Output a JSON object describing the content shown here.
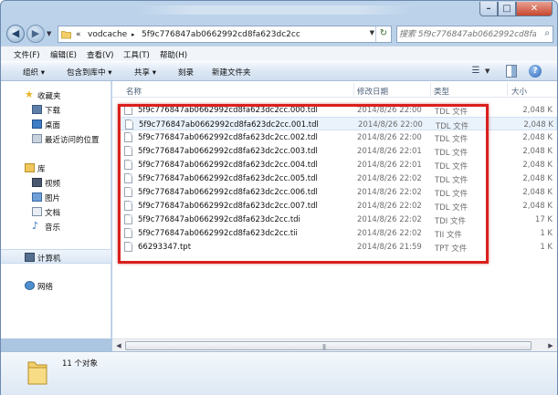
{
  "window": {
    "controls": {
      "minimize": "–",
      "maximize": "□",
      "close": "✕"
    }
  },
  "address": {
    "overflow": "«",
    "path": [
      "vodcache",
      "5f9c776847ab0662992cd8fa623dc2cc"
    ],
    "separator": "▸",
    "search_placeholder": "搜索 5f9c776847ab0662992cd8fa6..."
  },
  "menu": [
    "文件(F)",
    "编辑(E)",
    "查看(V)",
    "工具(T)",
    "帮助(H)"
  ],
  "toolbar": {
    "organize": "组织 ▾",
    "include_library": "包含到库中 ▾",
    "share": "共享 ▾",
    "burn": "刻录",
    "new_folder": "新建文件夹"
  },
  "nav": {
    "favorites": "收藏夹",
    "downloads": "下载",
    "desktop": "桌面",
    "recent": "最近访问的位置",
    "libraries": "库",
    "videos": "视频",
    "pictures": "图片",
    "documents": "文档",
    "music": "音乐",
    "computer": "计算机",
    "network": "网络"
  },
  "columns": {
    "name": "名称",
    "date": "修改日期",
    "type": "类型",
    "size": "大小"
  },
  "files": [
    {
      "name": "5f9c776847ab0662992cd8fa623dc2cc.000.tdl",
      "date": "2014/8/26 22:00",
      "type": "TDL 文件",
      "size": "2,048 K"
    },
    {
      "name": "5f9c776847ab0662992cd8fa623dc2cc.001.tdl",
      "date": "2014/8/26 22:00",
      "type": "TDL 文件",
      "size": "2,048 K"
    },
    {
      "name": "5f9c776847ab0662992cd8fa623dc2cc.002.tdl",
      "date": "2014/8/26 22:00",
      "type": "TDL 文件",
      "size": "2,048 K"
    },
    {
      "name": "5f9c776847ab0662992cd8fa623dc2cc.003.tdl",
      "date": "2014/8/26 22:01",
      "type": "TDL 文件",
      "size": "2,048 K"
    },
    {
      "name": "5f9c776847ab0662992cd8fa623dc2cc.004.tdl",
      "date": "2014/8/26 22:01",
      "type": "TDL 文件",
      "size": "2,048 K"
    },
    {
      "name": "5f9c776847ab0662992cd8fa623dc2cc.005.tdl",
      "date": "2014/8/26 22:02",
      "type": "TDL 文件",
      "size": "2,048 K"
    },
    {
      "name": "5f9c776847ab0662992cd8fa623dc2cc.006.tdl",
      "date": "2014/8/26 22:02",
      "type": "TDL 文件",
      "size": "2,048 K"
    },
    {
      "name": "5f9c776847ab0662992cd8fa623dc2cc.007.tdl",
      "date": "2014/8/26 22:02",
      "type": "TDL 文件",
      "size": "2,048 K"
    },
    {
      "name": "5f9c776847ab0662992cd8fa623dc2cc.tdi",
      "date": "2014/8/26 22:02",
      "type": "TDI 文件",
      "size": "17 K"
    },
    {
      "name": "5f9c776847ab0662992cd8fa623dc2cc.tii",
      "date": "2014/8/26 22:02",
      "type": "TII 文件",
      "size": "1 K"
    },
    {
      "name": "66293347.tpt",
      "date": "2014/8/26 21:59",
      "type": "TPT 文件",
      "size": "1 K"
    }
  ],
  "status": {
    "item_count": "11 个对象"
  },
  "colors": {
    "highlight_box": "#d9201c",
    "frame": "#bcd3ea"
  }
}
